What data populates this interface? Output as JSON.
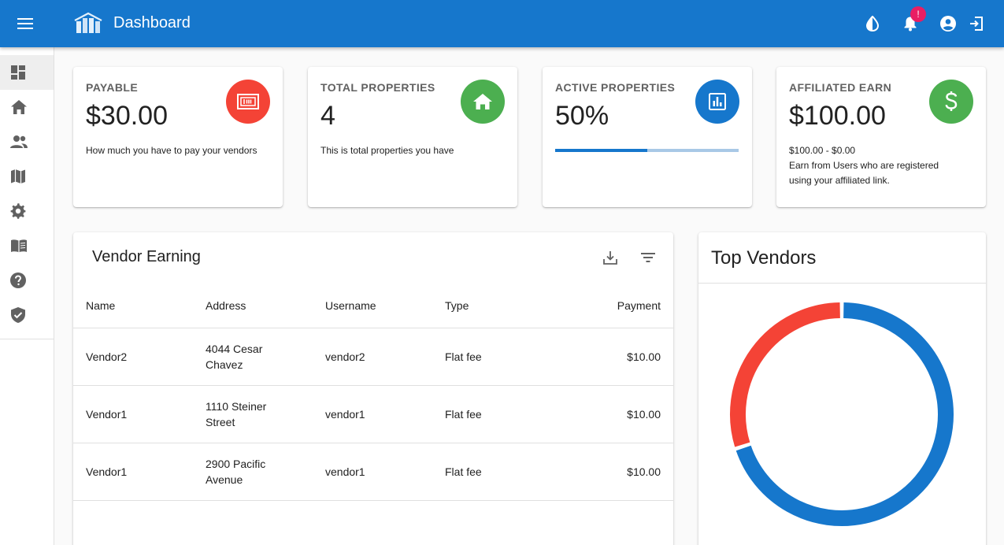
{
  "appbar": {
    "title": "Dashboard",
    "notification_badge": "!",
    "color": "#1677cc"
  },
  "sidebar": {
    "items": [
      {
        "icon": "dashboard-icon",
        "active": true
      },
      {
        "icon": "home-icon"
      },
      {
        "icon": "people-icon"
      },
      {
        "icon": "map-icon"
      },
      {
        "icon": "settings-icon"
      },
      {
        "icon": "book-icon"
      },
      {
        "icon": "help-icon"
      },
      {
        "icon": "shield-icon"
      }
    ]
  },
  "stats": {
    "payable": {
      "label": "PAYABLE",
      "value": "$30.00",
      "desc": "How much you have to pay your vendors",
      "icon": "money-icon",
      "color": "#f44336"
    },
    "total_properties": {
      "label": "TOTAL PROPERTIES",
      "value": "4",
      "desc": "This is total properties you have",
      "icon": "home-icon",
      "color": "#4caf50"
    },
    "active_properties": {
      "label": "ACTIVE PROPERTIES",
      "value": "50%",
      "progress": 0.5,
      "icon": "chart-icon",
      "color": "#1677cc"
    },
    "affiliated_earn": {
      "label": "AFFILIATED EARN",
      "value": "$100.00",
      "desc_line1": "$100.00 - $0.00",
      "desc_line2": "Earn from Users who are registered",
      "desc_line3": "using your affiliated link.",
      "icon": "dollar-icon",
      "color": "#4caf50"
    }
  },
  "vendor_earning": {
    "title": "Vendor Earning",
    "columns": [
      "Name",
      "Address",
      "Username",
      "Type",
      "Payment"
    ],
    "rows": [
      {
        "name": "Vendor2",
        "address1": "4044 Cesar",
        "address2": "Chavez",
        "username": "vendor2",
        "type": "Flat fee",
        "payment": "$10.00"
      },
      {
        "name": "Vendor1",
        "address1": "1110 Steiner",
        "address2": "Street",
        "username": "vendor1",
        "type": "Flat fee",
        "payment": "$10.00"
      },
      {
        "name": "Vendor1",
        "address1": "2900 Pacific",
        "address2": "Avenue",
        "username": "vendor1",
        "type": "Flat fee",
        "payment": "$10.00"
      }
    ]
  },
  "top_vendors": {
    "title": "Top Vendors"
  },
  "chart_data": {
    "type": "pie",
    "title": "Top Vendors",
    "values": [
      70,
      30
    ],
    "colors": [
      "#1677cc",
      "#f44336"
    ]
  }
}
